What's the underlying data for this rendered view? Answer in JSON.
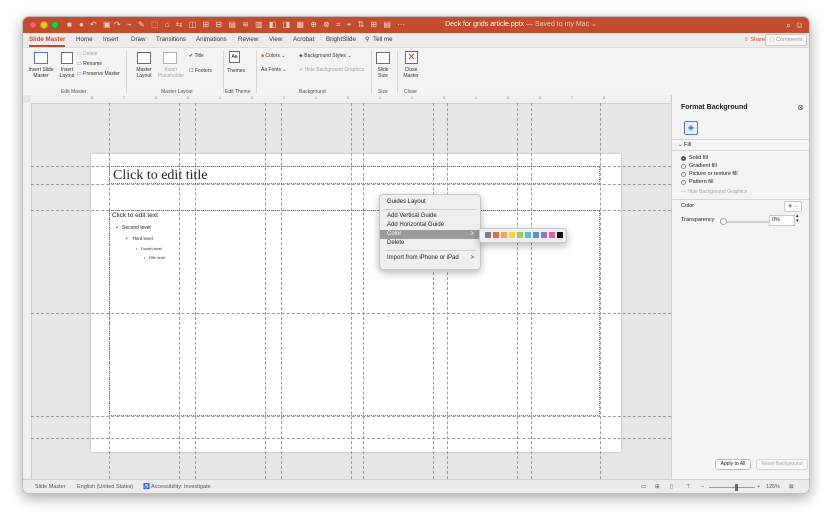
{
  "window": {
    "title": "Deck for grids article.pptx",
    "subtitle": "— Saved to my Mac ⌄"
  },
  "tabs": [
    {
      "label": "Slide Master",
      "active": true
    },
    {
      "label": "Home"
    },
    {
      "label": "Insert"
    },
    {
      "label": "Draw"
    },
    {
      "label": "Transitions"
    },
    {
      "label": "Animations"
    },
    {
      "label": "Review"
    },
    {
      "label": "View"
    },
    {
      "label": "Acrobat"
    },
    {
      "label": "BrightSlide"
    },
    {
      "label": "Tell me"
    }
  ],
  "share_label": "Share",
  "comments_label": "Comments",
  "ribbon": {
    "insert_slide_master": "Insert Slide Master",
    "insert_layout": "Insert Layout",
    "delete": "Delete",
    "rename": "Rename",
    "preserve_master": "Preserve Master",
    "edit_master_group": "Edit Master",
    "master_layout": "Master Layout",
    "insert_placeholder": "Insert Placeholder",
    "title_check": "Title",
    "footers_check": "Footers",
    "master_layout_group": "Master Layout",
    "themes": "Themes",
    "edit_theme_group": "Edit Theme",
    "colors": "Colors",
    "fonts": "Fonts",
    "background_styles": "Background Styles",
    "hide_bg_graphics": "Hide Background Graphics",
    "background_group": "Background",
    "slide_size": "Slide Size",
    "size_group": "Size",
    "close_master": "Close Master",
    "close_group": "Close"
  },
  "ruler_ticks": [
    "8",
    "7",
    "6",
    "5",
    "4",
    "3",
    "2",
    "1",
    "0",
    "1",
    "2",
    "3",
    "4",
    "5",
    "6",
    "7",
    "8"
  ],
  "slide": {
    "title": "Click to edit title",
    "body": "Click to edit text",
    "level2": "Second level",
    "level3": "Third level",
    "level4": "Fourth level",
    "level5": "Fifth level"
  },
  "context_menu": {
    "items": [
      "Guides Layout",
      "Add Vertical Guide",
      "Add Horizontal Guide",
      "Color",
      "Delete",
      "Import from iPhone or iPad"
    ],
    "highlighted": "Color"
  },
  "color_swatches": [
    "#7f7f7f",
    "#e36c3b",
    "#f2a65a",
    "#f5d14a",
    "#9ccc65",
    "#4fc3c7",
    "#5b8dd9",
    "#9a6fcf",
    "#e0609c",
    "#111111"
  ],
  "format_pane": {
    "title": "Format Background",
    "section": "Fill",
    "options": [
      "Solid fill",
      "Gradient fill",
      "Picture or texture fill",
      "Pattern fill"
    ],
    "selected_option": "Solid fill",
    "hide_bg": "Hide Background Graphics",
    "color_label": "Color",
    "transparency_label": "Transparency",
    "transparency_value": "0%",
    "apply_all": "Apply to All",
    "reset_bg": "Reset Background"
  },
  "status": {
    "view": "Slide Master",
    "language": "English (United States)",
    "accessibility": "Accessibility: Investigate",
    "zoom": "125%"
  },
  "accent_color": "#c34b2e"
}
